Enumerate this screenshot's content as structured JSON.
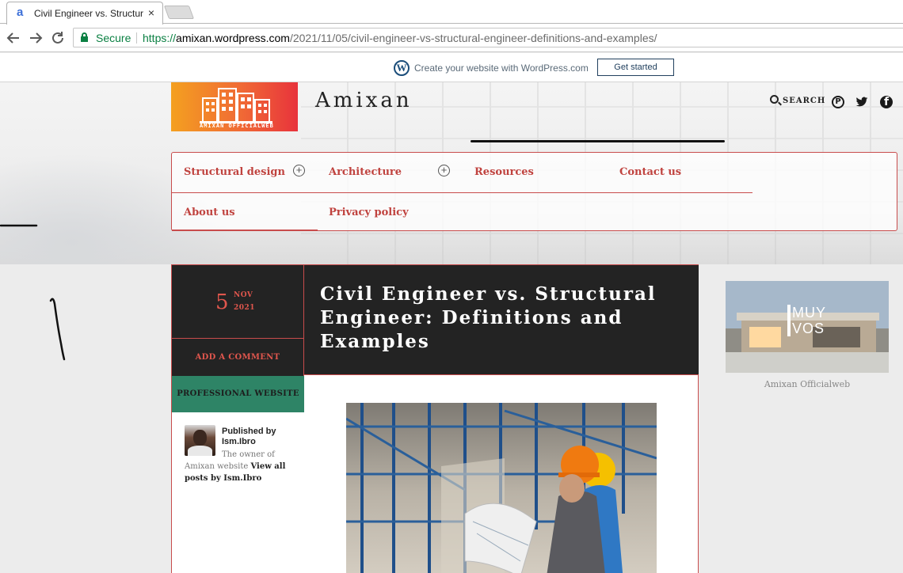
{
  "browser": {
    "tab_title": "Civil Engineer vs. Structur",
    "tab_close": "×",
    "security_label": "Secure",
    "url_scheme": "https://",
    "url_host": "amixan.wordpress.com",
    "url_path": "/2021/11/05/civil-engineer-vs-structural-engineer-definitions-and-examples/"
  },
  "wp_banner": {
    "logo_glyph": "W",
    "text": "Create your website with WordPress.com",
    "button": "Get started"
  },
  "site": {
    "title": "Amixan",
    "logo_text": "AMIXAN OFFICIALWEB",
    "search_label": "SEARCH",
    "social_icons": [
      "pinterest-icon",
      "twitter-icon",
      "facebook-icon"
    ]
  },
  "menu": {
    "items": [
      "Structural design",
      "Architecture",
      "Resources",
      "Contact us",
      "About us",
      "Privacy policy"
    ]
  },
  "post": {
    "day": "5",
    "month": "NOV",
    "year": "2021",
    "comment_label": "ADD A COMMENT",
    "category": "PROFESSIONAL WEBSITE",
    "title": "Civil Engineer vs. Structural Engineer: Definitions and Examples",
    "author_label": "Published by",
    "author_name": "Ism.Ibro",
    "author_bio": "The owner of Amixan website",
    "author_link": "View all posts by Ism.Ibro"
  },
  "sidebar": {
    "image_text": "MUY VOS",
    "caption": "Amixan Officialweb"
  },
  "colors": {
    "accent": "#c0433f",
    "dark": "#232323",
    "category_green": "#2e8466",
    "secure_green": "#0b8043"
  }
}
